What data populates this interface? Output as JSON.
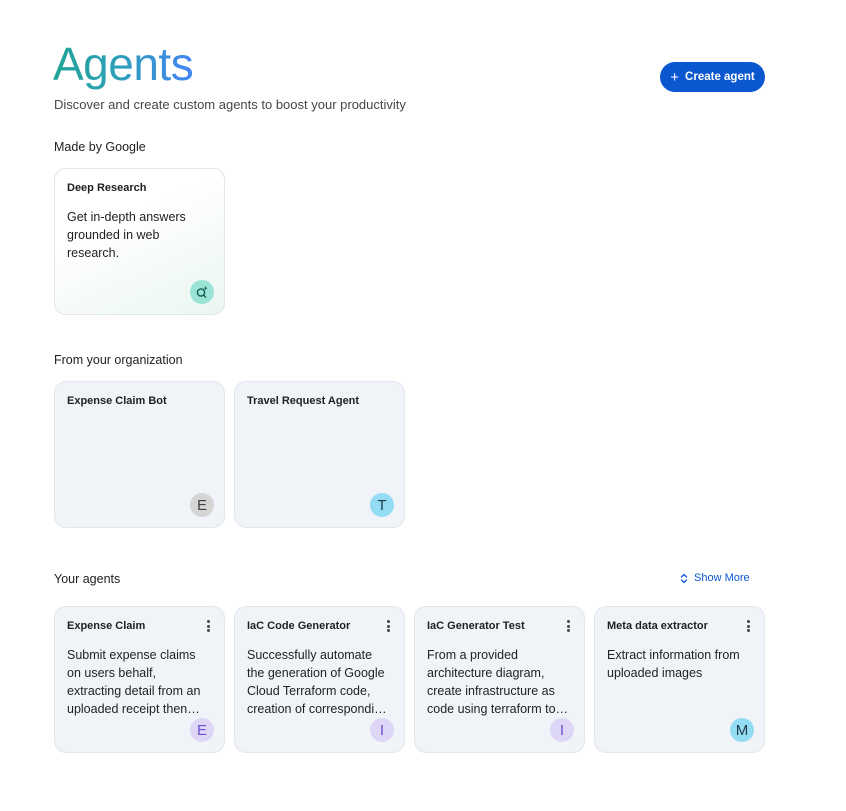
{
  "header": {
    "title": "Agents",
    "subtitle": "Discover and create custom agents to boost your productivity",
    "create_button": "Create agent"
  },
  "sections": {
    "google": {
      "label": "Made by Google",
      "cards": [
        {
          "title": "Deep Research",
          "description": "Get in-depth answers grounded in web research.",
          "icon": "deep-research-icon"
        }
      ]
    },
    "organization": {
      "label": "From your organization",
      "cards": [
        {
          "title": "Expense Claim Bot",
          "avatar": "E"
        },
        {
          "title": "Travel Request Agent",
          "avatar": "T"
        }
      ]
    },
    "yours": {
      "label": "Your agents",
      "show_more": "Show More",
      "cards": [
        {
          "title": "Expense Claim",
          "description": "Submit expense claims on users behalf, extracting detail from an uploaded receipt then submitting the claim.",
          "avatar": "E"
        },
        {
          "title": "IaC Code Generator",
          "description": "Successfully automate the generation of Google Cloud Terraform code, creation of corresponding documentation.",
          "avatar": "I"
        },
        {
          "title": "IaC Generator Test",
          "description": "From a provided architecture diagram, create infrastructure as code using terraform to deploy it.",
          "avatar": "I"
        },
        {
          "title": "Meta data extractor",
          "description": "Extract information from uploaded images",
          "avatar": "M"
        }
      ]
    }
  },
  "colors": {
    "primary": "#0b57d0",
    "card_bg": "#f0f4f9",
    "title_gradient_start": "#22a497",
    "title_gradient_end": "#4285f4"
  }
}
